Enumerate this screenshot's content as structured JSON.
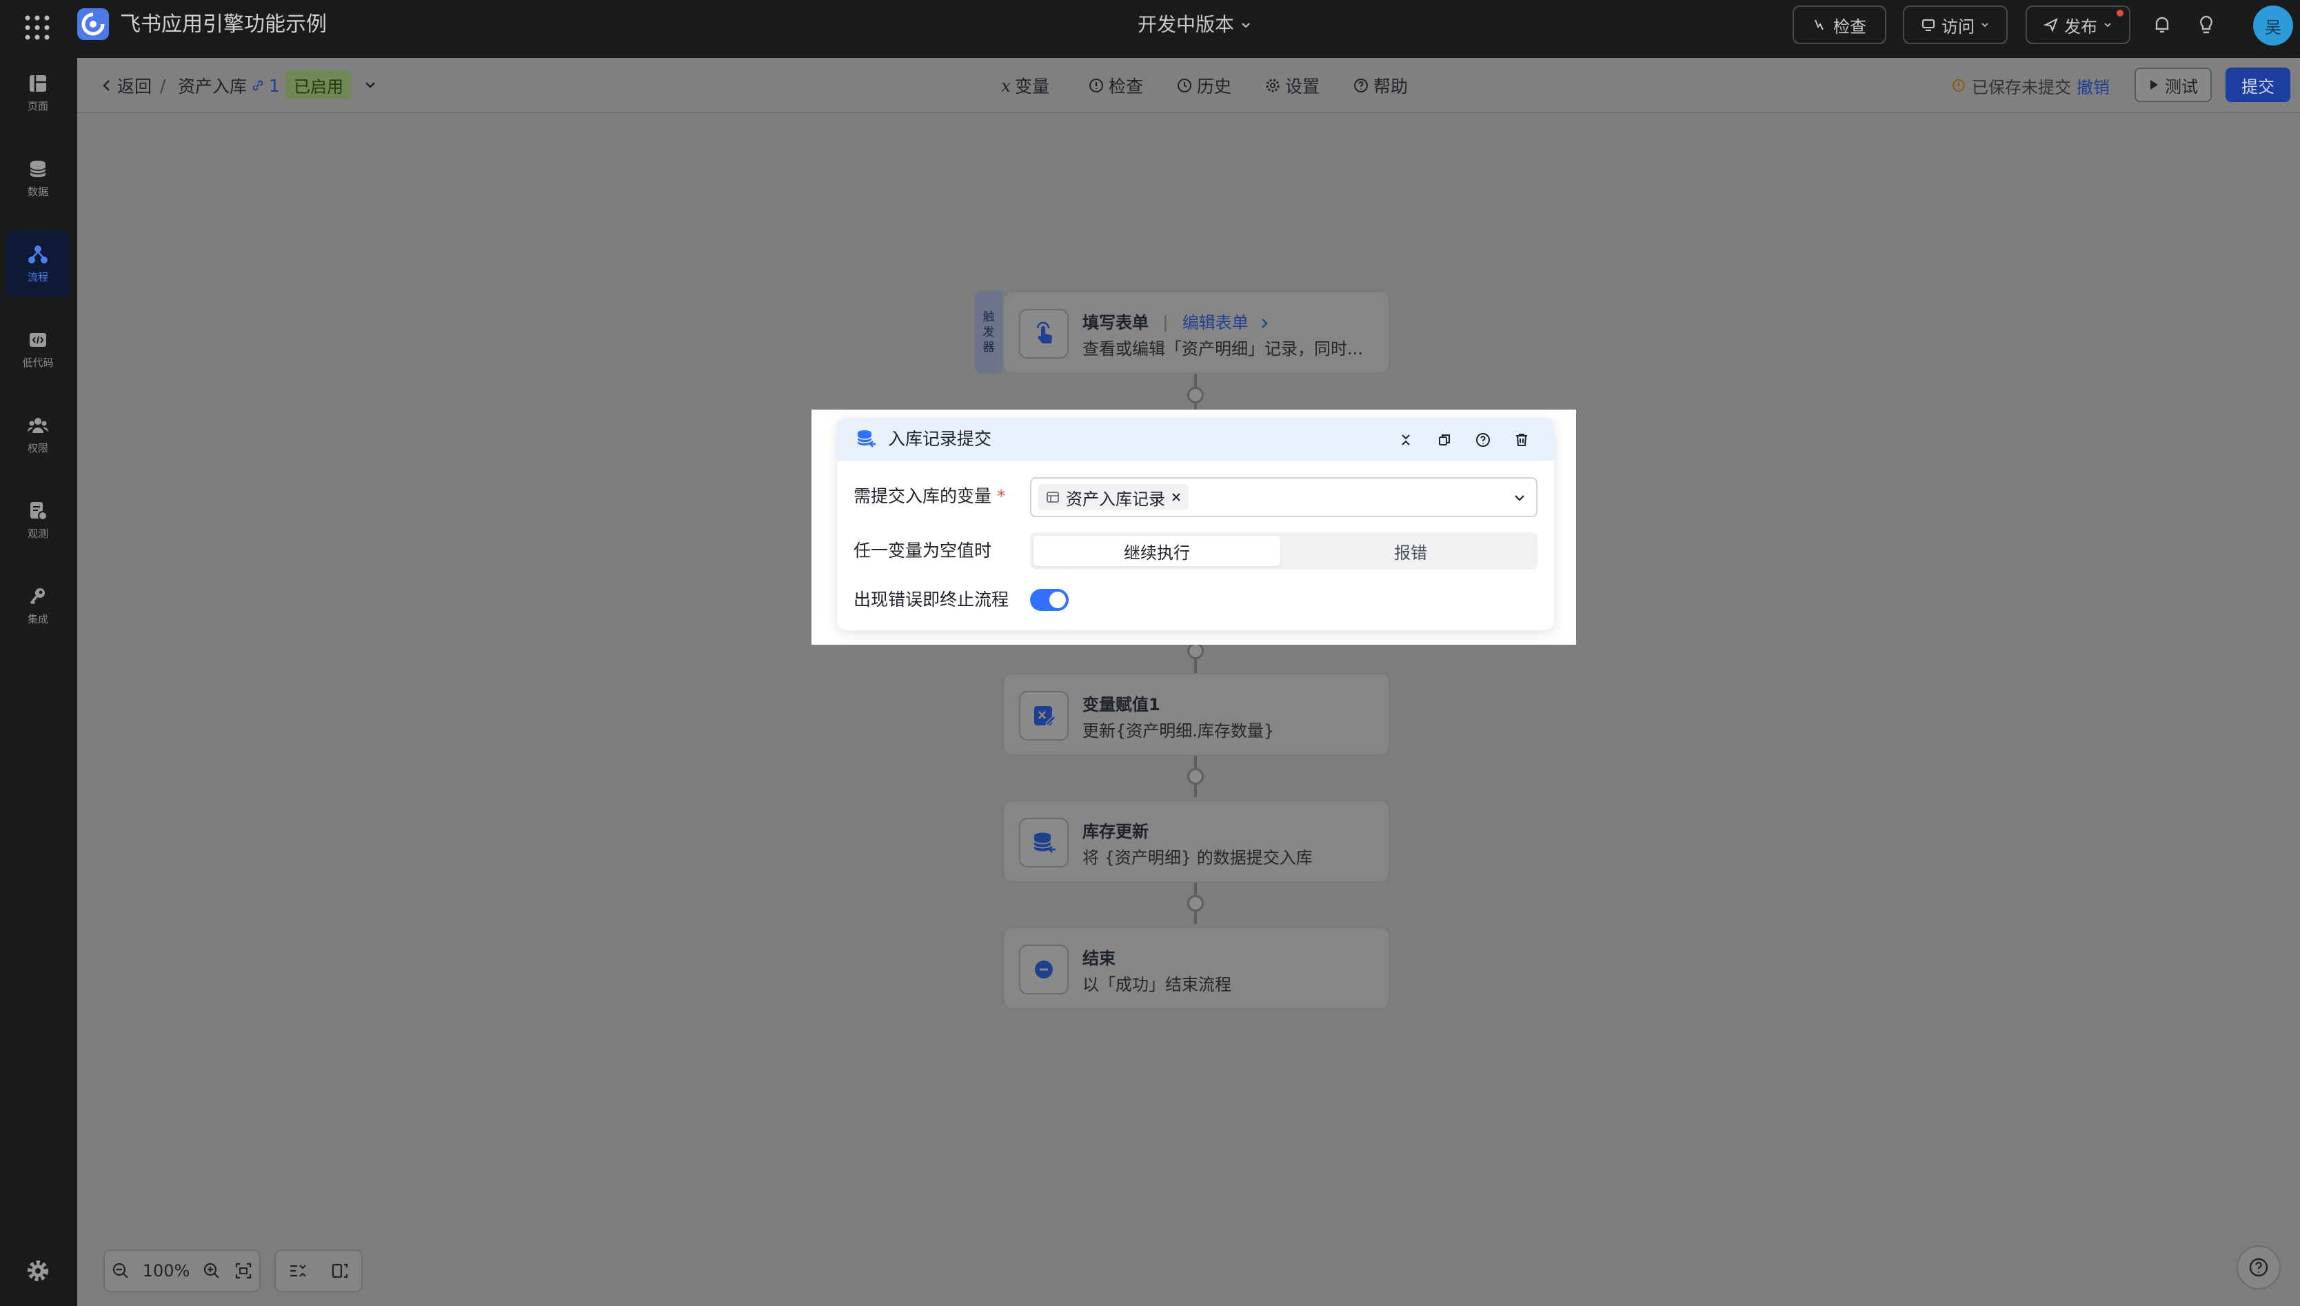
{
  "topbar": {
    "app_name": "飞书应用引擎功能示例",
    "version_label": "开发中版本",
    "check_label": "检查",
    "visit_label": "访问",
    "publish_label": "发布",
    "avatar_text": "吴"
  },
  "rail": {
    "items": [
      {
        "label": "页面",
        "icon": "layout-icon"
      },
      {
        "label": "数据",
        "icon": "database-icon"
      },
      {
        "label": "流程",
        "icon": "flow-icon"
      },
      {
        "label": "低代码",
        "icon": "code-icon"
      },
      {
        "label": "权限",
        "icon": "users-icon"
      },
      {
        "label": "观测",
        "icon": "monitor-icon"
      },
      {
        "label": "集成",
        "icon": "key-icon"
      }
    ],
    "active_index": 2
  },
  "subbar": {
    "back_label": "返回",
    "separator": "/",
    "flow_name": "资产入库",
    "version_count": "1",
    "status_badge": "已启用",
    "tools": {
      "variables": "变量",
      "check": "检查",
      "history": "历史",
      "settings": "设置",
      "help": "帮助"
    },
    "saved_notice": "已保存未提交",
    "revoke_label": "撤销",
    "test_label": "测试",
    "submit_label": "提交"
  },
  "flow": {
    "trigger_tag": [
      "触",
      "发",
      "器"
    ],
    "nodes": [
      {
        "title": "填写表单",
        "link": "编辑表单",
        "desc": "查看或编辑「资产明细」记录，同时..."
      },
      {
        "title": "变量赋值1",
        "desc": "更新{资产明细.库存数量}"
      },
      {
        "title": "库存更新",
        "desc": "将 {资产明细} 的数据提交入库"
      },
      {
        "title": "结束",
        "desc": "以「成功」结束流程"
      }
    ]
  },
  "dialog": {
    "title": "入库记录提交",
    "field1_label": "需提交入库的变量",
    "field1_required": "*",
    "field1_tag": "资产入库记录",
    "field2_label": "任一变量为空值时",
    "field2_options": [
      "继续执行",
      "报错"
    ],
    "field2_selected": "继续执行",
    "field3_label": "出现错误即终止流程",
    "field3_value": true
  },
  "zoom": {
    "level": "100%"
  },
  "colors": {
    "accent": "#3370ff",
    "enabled_badge": "#6f8a54",
    "rail_active": "#4f7dea"
  }
}
